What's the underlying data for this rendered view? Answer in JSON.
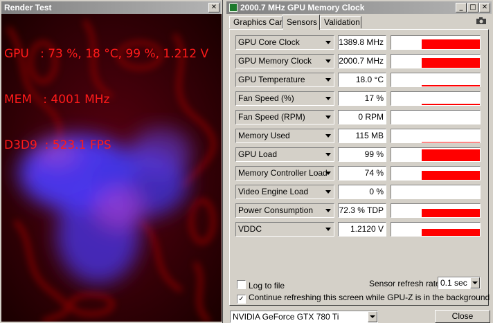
{
  "render_test": {
    "title": "Render Test",
    "close_glyph": "✕",
    "osd_lines": [
      "GPU   : 73 %, 18 °C, 99 %, 1.212 V",
      "MEM   : 4001 MHz",
      "D3D9  : 523.1 FPS"
    ]
  },
  "gpuz": {
    "title": "2000.7 MHz GPU Memory Clock",
    "window_buttons": [
      "_",
      "□",
      "✕"
    ],
    "tabs": [
      {
        "label": "Graphics Card",
        "active": false
      },
      {
        "label": "Sensors",
        "active": true
      },
      {
        "label": "Validation",
        "active": false
      }
    ],
    "camera_icon": "camera-icon",
    "sensors": [
      {
        "name": "GPU Core Clock",
        "value": "1389.8 MHz",
        "level": 0.8
      },
      {
        "name": "GPU Memory Clock",
        "value": "2000.7 MHz",
        "level": 0.85
      },
      {
        "name": "GPU Temperature",
        "value": "18.0 °C",
        "level": 0.1
      },
      {
        "name": "Fan Speed (%)",
        "value": "17 %",
        "level": 0.1
      },
      {
        "name": "Fan Speed (RPM)",
        "value": "0 RPM",
        "level": 0
      },
      {
        "name": "Memory Used",
        "value": "115 MB",
        "level": 0.05
      },
      {
        "name": "GPU Load",
        "value": "99 %",
        "level": 0.99
      },
      {
        "name": "Memory Controller Load",
        "value": "74 %",
        "level": 0.74
      },
      {
        "name": "Video Engine Load",
        "value": "0 %",
        "level": 0
      },
      {
        "name": "Power Consumption",
        "value": "72.3 % TDP",
        "level": 0.72
      },
      {
        "name": "VDDC",
        "value": "1.2120 V",
        "level": 0.6
      }
    ],
    "log_to_file": {
      "label": "Log to file",
      "checked": false
    },
    "continue_refresh": {
      "label": "Continue refreshing this screen while GPU-Z is in the background",
      "checked": true
    },
    "refresh_rate": {
      "label": "Sensor refresh rate:",
      "value": "0.1 sec"
    },
    "gpu_select": "NVIDIA GeForce GTX 780 Ti",
    "close_label": "Close",
    "graph_color": "#ff0000"
  }
}
